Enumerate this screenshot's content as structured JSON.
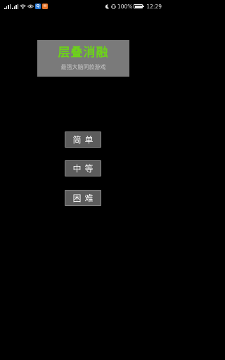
{
  "status_bar": {
    "left_icons": [
      "signal-icon",
      "signal-icon",
      "wifi-icon",
      "eye-icon",
      "notification-app-icon",
      "notification-app-icon"
    ],
    "app_chips": [
      {
        "name": "app-blue-icon",
        "glyph": "Q",
        "color": "#2a7bd8"
      },
      {
        "name": "app-orange-icon",
        "glyph": "✉",
        "color": "#e8762a"
      }
    ],
    "battery_percent": "100%",
    "time": "12:29"
  },
  "title_card": {
    "title": "层叠消融",
    "subtitle": "最强大脑同款游戏",
    "title_color": "#6dd21a",
    "background_color": "#7a7a7a"
  },
  "menu": {
    "easy_label": "简单",
    "medium_label": "中等",
    "hard_label": "困难"
  }
}
